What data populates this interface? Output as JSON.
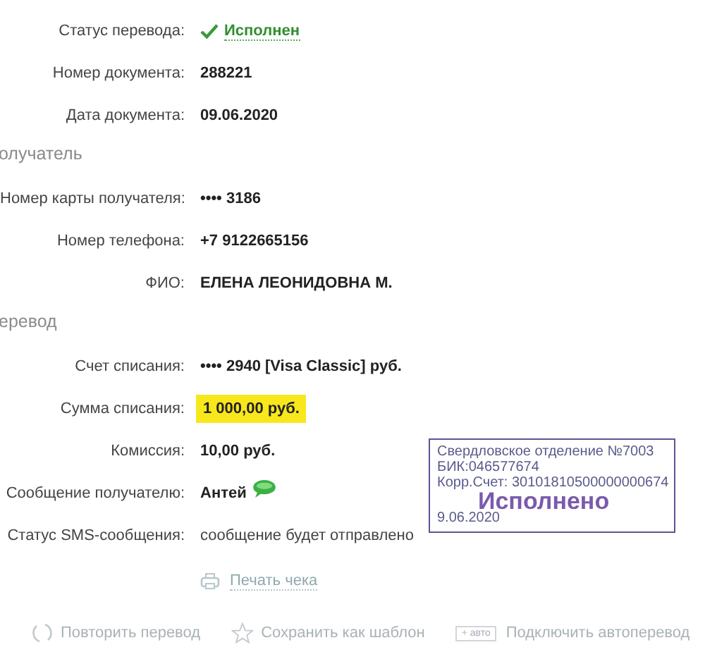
{
  "sections": [
    {
      "rows": [
        {
          "label": "Статус перевода:",
          "value": "Исполнен",
          "kind": "status"
        },
        {
          "label": "Номер документа:",
          "value": "288221",
          "kind": "bold"
        },
        {
          "label": "Дата документа:",
          "value": "09.06.2020",
          "kind": "bold"
        }
      ]
    },
    {
      "heading": "олучатель",
      "rows": [
        {
          "label": "Номер карты получателя:",
          "value": "•••• 3186",
          "kind": "bold"
        },
        {
          "label": "Номер телефона:",
          "value": "+7 9122665156",
          "kind": "bold"
        },
        {
          "label": "ФИО:",
          "value": "ЕЛЕНА ЛЕОНИДОВНА М.",
          "kind": "bold"
        }
      ]
    },
    {
      "heading": "еревод",
      "rows": [
        {
          "label": "Счет списания:",
          "value": "•••• 2940  [Visa Classic]  руб.",
          "kind": "bold"
        },
        {
          "label": "Сумма списания:",
          "value": "1 000,00  руб.",
          "kind": "highlight"
        },
        {
          "label": "Комиссия:",
          "value": "10,00 руб.",
          "kind": "bold"
        },
        {
          "label": "Сообщение получателю:",
          "value": "Антей",
          "kind": "message"
        },
        {
          "label": "Статус SMS-сообщения:",
          "value": "сообщение будет отправлено",
          "kind": "plain"
        }
      ]
    }
  ],
  "print_link": "Печать чека",
  "actions": [
    {
      "label": "Повторить перевод",
      "kind": "repeat"
    },
    {
      "label": "Сохранить как шаблон",
      "kind": "star"
    },
    {
      "label": "Подключить автоперевод",
      "kind": "auto",
      "badge_plus": "+",
      "badge": "авто"
    }
  ],
  "stamp": {
    "lines": [
      "Свердловское отделение №7003",
      "БИК:046577674",
      "Корр.Счет: 30101810500000000674"
    ],
    "mark": "Исполнено",
    "date": "9.06.2020"
  }
}
